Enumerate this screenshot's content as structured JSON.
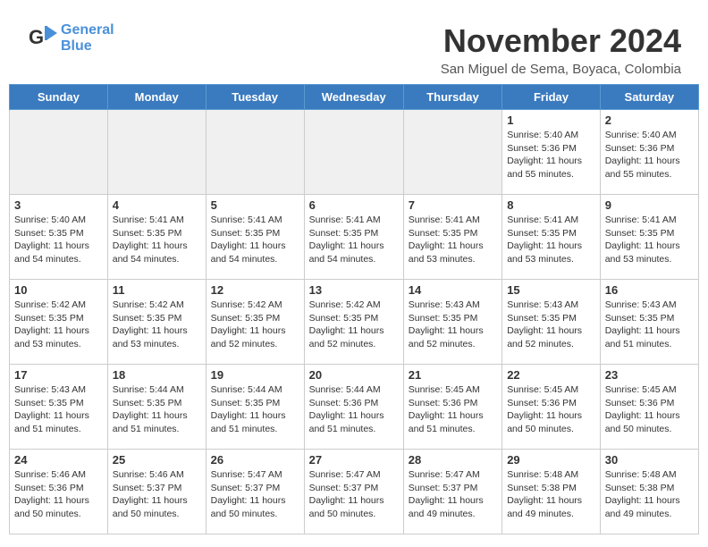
{
  "header": {
    "logo_line1": "General",
    "logo_line2": "Blue",
    "month_year": "November 2024",
    "location": "San Miguel de Sema, Boyaca, Colombia"
  },
  "days_of_week": [
    "Sunday",
    "Monday",
    "Tuesday",
    "Wednesday",
    "Thursday",
    "Friday",
    "Saturday"
  ],
  "weeks": [
    [
      {
        "day": "",
        "info": ""
      },
      {
        "day": "",
        "info": ""
      },
      {
        "day": "",
        "info": ""
      },
      {
        "day": "",
        "info": ""
      },
      {
        "day": "",
        "info": ""
      },
      {
        "day": "1",
        "info": "Sunrise: 5:40 AM\nSunset: 5:36 PM\nDaylight: 11 hours and 55 minutes."
      },
      {
        "day": "2",
        "info": "Sunrise: 5:40 AM\nSunset: 5:36 PM\nDaylight: 11 hours and 55 minutes."
      }
    ],
    [
      {
        "day": "3",
        "info": "Sunrise: 5:40 AM\nSunset: 5:35 PM\nDaylight: 11 hours and 54 minutes."
      },
      {
        "day": "4",
        "info": "Sunrise: 5:41 AM\nSunset: 5:35 PM\nDaylight: 11 hours and 54 minutes."
      },
      {
        "day": "5",
        "info": "Sunrise: 5:41 AM\nSunset: 5:35 PM\nDaylight: 11 hours and 54 minutes."
      },
      {
        "day": "6",
        "info": "Sunrise: 5:41 AM\nSunset: 5:35 PM\nDaylight: 11 hours and 54 minutes."
      },
      {
        "day": "7",
        "info": "Sunrise: 5:41 AM\nSunset: 5:35 PM\nDaylight: 11 hours and 53 minutes."
      },
      {
        "day": "8",
        "info": "Sunrise: 5:41 AM\nSunset: 5:35 PM\nDaylight: 11 hours and 53 minutes."
      },
      {
        "day": "9",
        "info": "Sunrise: 5:41 AM\nSunset: 5:35 PM\nDaylight: 11 hours and 53 minutes."
      }
    ],
    [
      {
        "day": "10",
        "info": "Sunrise: 5:42 AM\nSunset: 5:35 PM\nDaylight: 11 hours and 53 minutes."
      },
      {
        "day": "11",
        "info": "Sunrise: 5:42 AM\nSunset: 5:35 PM\nDaylight: 11 hours and 53 minutes."
      },
      {
        "day": "12",
        "info": "Sunrise: 5:42 AM\nSunset: 5:35 PM\nDaylight: 11 hours and 52 minutes."
      },
      {
        "day": "13",
        "info": "Sunrise: 5:42 AM\nSunset: 5:35 PM\nDaylight: 11 hours and 52 minutes."
      },
      {
        "day": "14",
        "info": "Sunrise: 5:43 AM\nSunset: 5:35 PM\nDaylight: 11 hours and 52 minutes."
      },
      {
        "day": "15",
        "info": "Sunrise: 5:43 AM\nSunset: 5:35 PM\nDaylight: 11 hours and 52 minutes."
      },
      {
        "day": "16",
        "info": "Sunrise: 5:43 AM\nSunset: 5:35 PM\nDaylight: 11 hours and 51 minutes."
      }
    ],
    [
      {
        "day": "17",
        "info": "Sunrise: 5:43 AM\nSunset: 5:35 PM\nDaylight: 11 hours and 51 minutes."
      },
      {
        "day": "18",
        "info": "Sunrise: 5:44 AM\nSunset: 5:35 PM\nDaylight: 11 hours and 51 minutes."
      },
      {
        "day": "19",
        "info": "Sunrise: 5:44 AM\nSunset: 5:35 PM\nDaylight: 11 hours and 51 minutes."
      },
      {
        "day": "20",
        "info": "Sunrise: 5:44 AM\nSunset: 5:36 PM\nDaylight: 11 hours and 51 minutes."
      },
      {
        "day": "21",
        "info": "Sunrise: 5:45 AM\nSunset: 5:36 PM\nDaylight: 11 hours and 51 minutes."
      },
      {
        "day": "22",
        "info": "Sunrise: 5:45 AM\nSunset: 5:36 PM\nDaylight: 11 hours and 50 minutes."
      },
      {
        "day": "23",
        "info": "Sunrise: 5:45 AM\nSunset: 5:36 PM\nDaylight: 11 hours and 50 minutes."
      }
    ],
    [
      {
        "day": "24",
        "info": "Sunrise: 5:46 AM\nSunset: 5:36 PM\nDaylight: 11 hours and 50 minutes."
      },
      {
        "day": "25",
        "info": "Sunrise: 5:46 AM\nSunset: 5:37 PM\nDaylight: 11 hours and 50 minutes."
      },
      {
        "day": "26",
        "info": "Sunrise: 5:47 AM\nSunset: 5:37 PM\nDaylight: 11 hours and 50 minutes."
      },
      {
        "day": "27",
        "info": "Sunrise: 5:47 AM\nSunset: 5:37 PM\nDaylight: 11 hours and 50 minutes."
      },
      {
        "day": "28",
        "info": "Sunrise: 5:47 AM\nSunset: 5:37 PM\nDaylight: 11 hours and 49 minutes."
      },
      {
        "day": "29",
        "info": "Sunrise: 5:48 AM\nSunset: 5:38 PM\nDaylight: 11 hours and 49 minutes."
      },
      {
        "day": "30",
        "info": "Sunrise: 5:48 AM\nSunset: 5:38 PM\nDaylight: 11 hours and 49 minutes."
      }
    ]
  ]
}
